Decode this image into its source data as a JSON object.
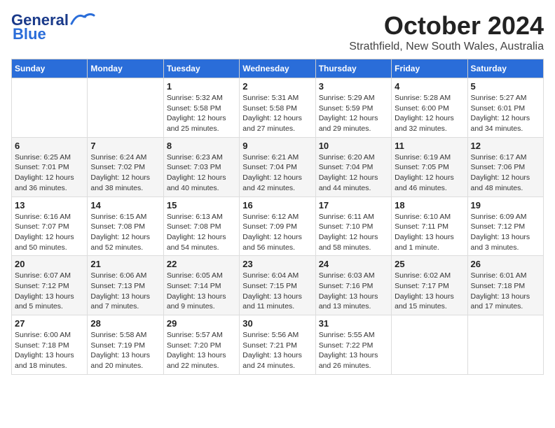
{
  "logo": {
    "general": "General",
    "blue": "Blue"
  },
  "title": "October 2024",
  "subtitle": "Strathfield, New South Wales, Australia",
  "days": [
    "Sunday",
    "Monday",
    "Tuesday",
    "Wednesday",
    "Thursday",
    "Friday",
    "Saturday"
  ],
  "weeks": [
    [
      {
        "date": "",
        "info": ""
      },
      {
        "date": "",
        "info": ""
      },
      {
        "date": "1",
        "info": "Sunrise: 5:32 AM\nSunset: 5:58 PM\nDaylight: 12 hours\nand 25 minutes."
      },
      {
        "date": "2",
        "info": "Sunrise: 5:31 AM\nSunset: 5:58 PM\nDaylight: 12 hours\nand 27 minutes."
      },
      {
        "date": "3",
        "info": "Sunrise: 5:29 AM\nSunset: 5:59 PM\nDaylight: 12 hours\nand 29 minutes."
      },
      {
        "date": "4",
        "info": "Sunrise: 5:28 AM\nSunset: 6:00 PM\nDaylight: 12 hours\nand 32 minutes."
      },
      {
        "date": "5",
        "info": "Sunrise: 5:27 AM\nSunset: 6:01 PM\nDaylight: 12 hours\nand 34 minutes."
      }
    ],
    [
      {
        "date": "6",
        "info": "Sunrise: 6:25 AM\nSunset: 7:01 PM\nDaylight: 12 hours\nand 36 minutes."
      },
      {
        "date": "7",
        "info": "Sunrise: 6:24 AM\nSunset: 7:02 PM\nDaylight: 12 hours\nand 38 minutes."
      },
      {
        "date": "8",
        "info": "Sunrise: 6:23 AM\nSunset: 7:03 PM\nDaylight: 12 hours\nand 40 minutes."
      },
      {
        "date": "9",
        "info": "Sunrise: 6:21 AM\nSunset: 7:04 PM\nDaylight: 12 hours\nand 42 minutes."
      },
      {
        "date": "10",
        "info": "Sunrise: 6:20 AM\nSunset: 7:04 PM\nDaylight: 12 hours\nand 44 minutes."
      },
      {
        "date": "11",
        "info": "Sunrise: 6:19 AM\nSunset: 7:05 PM\nDaylight: 12 hours\nand 46 minutes."
      },
      {
        "date": "12",
        "info": "Sunrise: 6:17 AM\nSunset: 7:06 PM\nDaylight: 12 hours\nand 48 minutes."
      }
    ],
    [
      {
        "date": "13",
        "info": "Sunrise: 6:16 AM\nSunset: 7:07 PM\nDaylight: 12 hours\nand 50 minutes."
      },
      {
        "date": "14",
        "info": "Sunrise: 6:15 AM\nSunset: 7:08 PM\nDaylight: 12 hours\nand 52 minutes."
      },
      {
        "date": "15",
        "info": "Sunrise: 6:13 AM\nSunset: 7:08 PM\nDaylight: 12 hours\nand 54 minutes."
      },
      {
        "date": "16",
        "info": "Sunrise: 6:12 AM\nSunset: 7:09 PM\nDaylight: 12 hours\nand 56 minutes."
      },
      {
        "date": "17",
        "info": "Sunrise: 6:11 AM\nSunset: 7:10 PM\nDaylight: 12 hours\nand 58 minutes."
      },
      {
        "date": "18",
        "info": "Sunrise: 6:10 AM\nSunset: 7:11 PM\nDaylight: 13 hours\nand 1 minute."
      },
      {
        "date": "19",
        "info": "Sunrise: 6:09 AM\nSunset: 7:12 PM\nDaylight: 13 hours\nand 3 minutes."
      }
    ],
    [
      {
        "date": "20",
        "info": "Sunrise: 6:07 AM\nSunset: 7:12 PM\nDaylight: 13 hours\nand 5 minutes."
      },
      {
        "date": "21",
        "info": "Sunrise: 6:06 AM\nSunset: 7:13 PM\nDaylight: 13 hours\nand 7 minutes."
      },
      {
        "date": "22",
        "info": "Sunrise: 6:05 AM\nSunset: 7:14 PM\nDaylight: 13 hours\nand 9 minutes."
      },
      {
        "date": "23",
        "info": "Sunrise: 6:04 AM\nSunset: 7:15 PM\nDaylight: 13 hours\nand 11 minutes."
      },
      {
        "date": "24",
        "info": "Sunrise: 6:03 AM\nSunset: 7:16 PM\nDaylight: 13 hours\nand 13 minutes."
      },
      {
        "date": "25",
        "info": "Sunrise: 6:02 AM\nSunset: 7:17 PM\nDaylight: 13 hours\nand 15 minutes."
      },
      {
        "date": "26",
        "info": "Sunrise: 6:01 AM\nSunset: 7:18 PM\nDaylight: 13 hours\nand 17 minutes."
      }
    ],
    [
      {
        "date": "27",
        "info": "Sunrise: 6:00 AM\nSunset: 7:18 PM\nDaylight: 13 hours\nand 18 minutes."
      },
      {
        "date": "28",
        "info": "Sunrise: 5:58 AM\nSunset: 7:19 PM\nDaylight: 13 hours\nand 20 minutes."
      },
      {
        "date": "29",
        "info": "Sunrise: 5:57 AM\nSunset: 7:20 PM\nDaylight: 13 hours\nand 22 minutes."
      },
      {
        "date": "30",
        "info": "Sunrise: 5:56 AM\nSunset: 7:21 PM\nDaylight: 13 hours\nand 24 minutes."
      },
      {
        "date": "31",
        "info": "Sunrise: 5:55 AM\nSunset: 7:22 PM\nDaylight: 13 hours\nand 26 minutes."
      },
      {
        "date": "",
        "info": ""
      },
      {
        "date": "",
        "info": ""
      }
    ]
  ]
}
